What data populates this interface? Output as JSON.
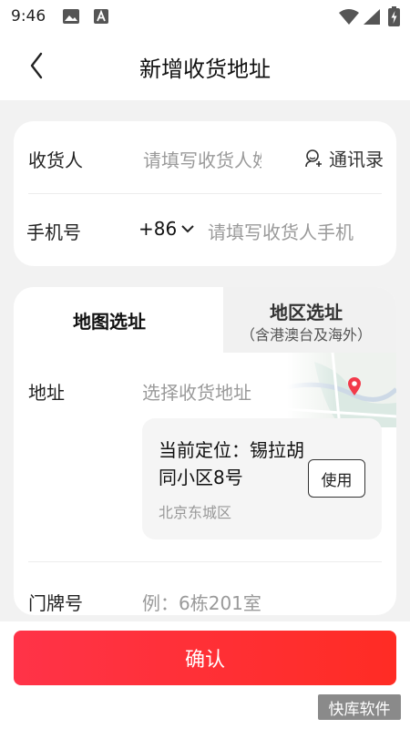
{
  "status_bar": {
    "time": "9:46"
  },
  "header": {
    "title": "新增收货地址"
  },
  "receiver_card": {
    "name_label": "收货人",
    "name_placeholder": "请填写收货人姓名",
    "contacts_label": "通讯录",
    "phone_label": "手机号",
    "country_code": "+86",
    "phone_placeholder": "请填写收货人手机号"
  },
  "address_card": {
    "tab_map": "地图选址",
    "tab_region": "地区选址",
    "tab_region_sub": "（含港澳台及海外）",
    "address_label": "地址",
    "address_placeholder": "选择收货地址",
    "current_location_title": "当前定位：锡拉胡同小区8号",
    "current_location_district": "北京东城区",
    "use_button": "使用",
    "door_label": "门牌号",
    "door_placeholder": "例：6栋201室"
  },
  "footer": {
    "confirm": "确认",
    "watermark": "快库软件"
  },
  "colors": {
    "accent": "#ff2e3a",
    "pin": "#f23a4a"
  }
}
